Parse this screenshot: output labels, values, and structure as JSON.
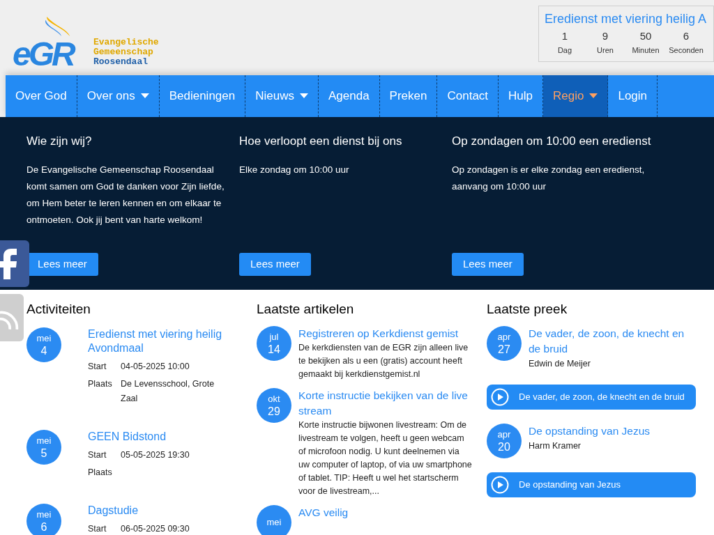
{
  "logo": {
    "mark": "eGR",
    "lines": [
      {
        "text": "Evangelische",
        "color": "#e0a800"
      },
      {
        "text": "Gemeenschap",
        "color": "#e0a800"
      },
      {
        "text": "Roosendaal",
        "color": "#1f5fa8"
      }
    ]
  },
  "countdown": {
    "title": "Eredienst met viering heilig A",
    "units": [
      {
        "value": "1",
        "label": "Dag"
      },
      {
        "value": "9",
        "label": "Uren"
      },
      {
        "value": "50",
        "label": "Minuten"
      },
      {
        "value": "6",
        "label": "Seconden"
      }
    ]
  },
  "nav": [
    {
      "label": "Over God",
      "dropdown": false,
      "selected": false
    },
    {
      "label": "Over ons",
      "dropdown": true,
      "selected": false
    },
    {
      "label": "Bedieningen",
      "dropdown": false,
      "selected": false
    },
    {
      "label": "Nieuws",
      "dropdown": true,
      "selected": false
    },
    {
      "label": "Agenda",
      "dropdown": false,
      "selected": false
    },
    {
      "label": "Preken",
      "dropdown": false,
      "selected": false
    },
    {
      "label": "Contact",
      "dropdown": false,
      "selected": false
    },
    {
      "label": "Hulp",
      "dropdown": false,
      "selected": false
    },
    {
      "label": "Regio",
      "dropdown": true,
      "selected": true
    },
    {
      "label": "Login",
      "dropdown": false,
      "selected": false
    }
  ],
  "intro": [
    {
      "title": "Wie zijn wij?",
      "text": "De Evangelische Gemeenschap Roosendaal komt samen om God te danken voor Zijn liefde, om Hem beter te leren kennen en om elkaar te ontmoeten. Ook jij bent van harte welkom!",
      "button": "Lees meer"
    },
    {
      "title": "Hoe verloopt een dienst bij ons",
      "text": "Elke zondag om 10:00 uur",
      "button": "Lees meer"
    },
    {
      "title": "Op zondagen om 10:00 een eredienst",
      "text": "Op zondagen is er elke zondag een eredienst, aanvang om 10:00 uur",
      "button": "Lees meer"
    }
  ],
  "social": [
    {
      "kind": "facebook"
    },
    {
      "kind": "rss"
    }
  ],
  "activities": {
    "title": "Activiteiten",
    "items": [
      {
        "month": "mei",
        "day": "4",
        "title": "Eredienst met viering heilig Avondmaal",
        "fields": [
          {
            "label": "Start",
            "value": "04-05-2025 10:00"
          },
          {
            "label": "Plaats",
            "value": "De Levensschool, Grote Zaal"
          }
        ]
      },
      {
        "month": "mei",
        "day": "5",
        "title": "GEEN Bidstond",
        "fields": [
          {
            "label": "Start",
            "value": "05-05-2025 19:30"
          },
          {
            "label": "Plaats"
          }
        ]
      },
      {
        "month": "mei",
        "day": "6",
        "title": "Dagstudie",
        "fields": [
          {
            "label": "Start",
            "value": "06-05-2025 09:30"
          }
        ]
      }
    ]
  },
  "articles": {
    "title": "Laatste artikelen",
    "items": [
      {
        "month": "jul",
        "day": "14",
        "title": "Registreren op Kerkdienst gemist",
        "text": "De kerkdiensten van de EGR zijn alleen live te bekijken als u een (gratis) account heeft gemaakt bij kerkdienstgemist.nl"
      },
      {
        "month": "okt",
        "day": "29",
        "title": "Korte instructie bekijken van de live stream",
        "text": "Korte instructie bijwonen livestream: Om de livestream te volgen, heeft u geen webcam of microfoon nodig. U kunt deelnemen via uw computer of laptop, of via uw smartphone of tablet. TIP: Heeft u wel het startscherm voor de livestream,..."
      },
      {
        "month": "mei",
        "title": "AVG veilig"
      }
    ]
  },
  "sermons": {
    "title": "Laatste preek",
    "items": [
      {
        "month": "apr",
        "day": "27",
        "title": "De vader, de zoon, de knecht en de bruid",
        "speaker": "Edwin de Meijer",
        "player": "De vader, de zoon, de knecht en de bruid"
      },
      {
        "month": "apr",
        "day": "20",
        "title": "De opstanding van Jezus",
        "speaker": "Harm Kramer",
        "player": "De opstanding van Jezus"
      }
    ]
  }
}
